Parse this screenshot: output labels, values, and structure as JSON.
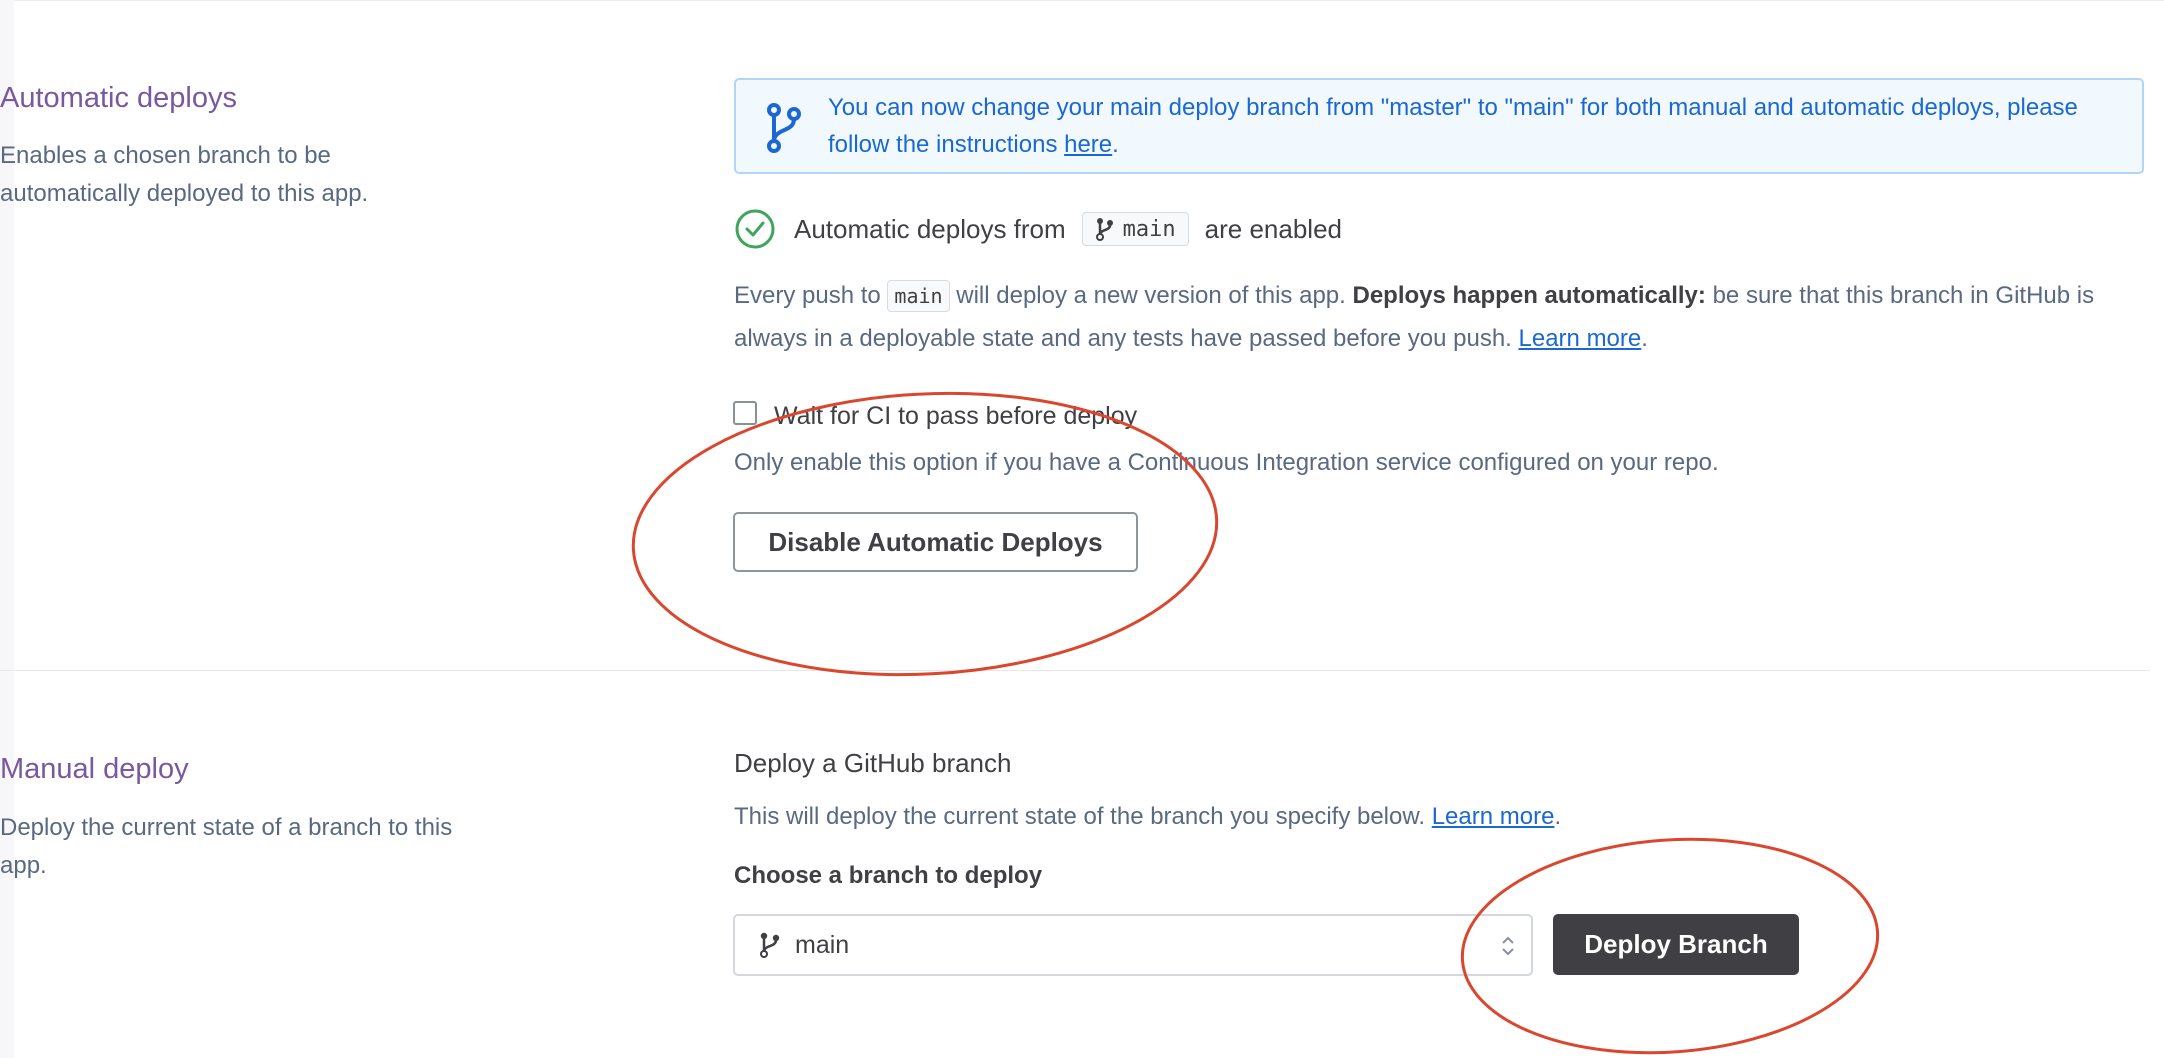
{
  "automatic_deploys": {
    "title": "Automatic deploys",
    "description": "Enables a chosen branch to be automatically deployed to this app.",
    "banner": {
      "text": "You can now change your main deploy branch from \"master\" to \"main\" for both manual and automatic deploys, please follow the instructions ",
      "link_label": "here",
      "suffix": "."
    },
    "status": {
      "prefix": "Automatic deploys from",
      "branch": "main",
      "suffix": "are enabled"
    },
    "push_info": {
      "part1": "Every push to",
      "branch": "main",
      "part2": "will deploy a new version of this app.",
      "bold": "Deploys happen automatically:",
      "part3": "be sure that this branch in GitHub is always in a deployable state and any tests have passed before you push.",
      "link_label": "Learn more",
      "suffix": "."
    },
    "ci_checkbox": {
      "label": "Wait for CI to pass before deploy",
      "checked": false,
      "hint": "Only enable this option if you have a Continuous Integration service configured on your repo."
    },
    "disable_button": "Disable Automatic Deploys"
  },
  "manual_deploy": {
    "title": "Manual deploy",
    "description": "Deploy the current state of a branch to this app.",
    "subheading": "Deploy a GitHub branch",
    "info": "This will deploy the current state of the branch you specify below.",
    "link_label": "Learn more",
    "suffix": ".",
    "choose_label": "Choose a branch to deploy",
    "selected_branch": "main",
    "deploy_button": "Deploy Branch"
  },
  "icons": {
    "banner": "git-branch-icon",
    "status": "check-circle-icon",
    "branch": "git-branch-icon",
    "select": "select-caret-icon"
  },
  "colors": {
    "section_title": "#79589f",
    "banner_text": "#1b68d3",
    "banner_bg": "#f1f8fe",
    "success": "#3ea65c",
    "dark_button": "#3f3f44",
    "annotation": "#d9472f"
  }
}
